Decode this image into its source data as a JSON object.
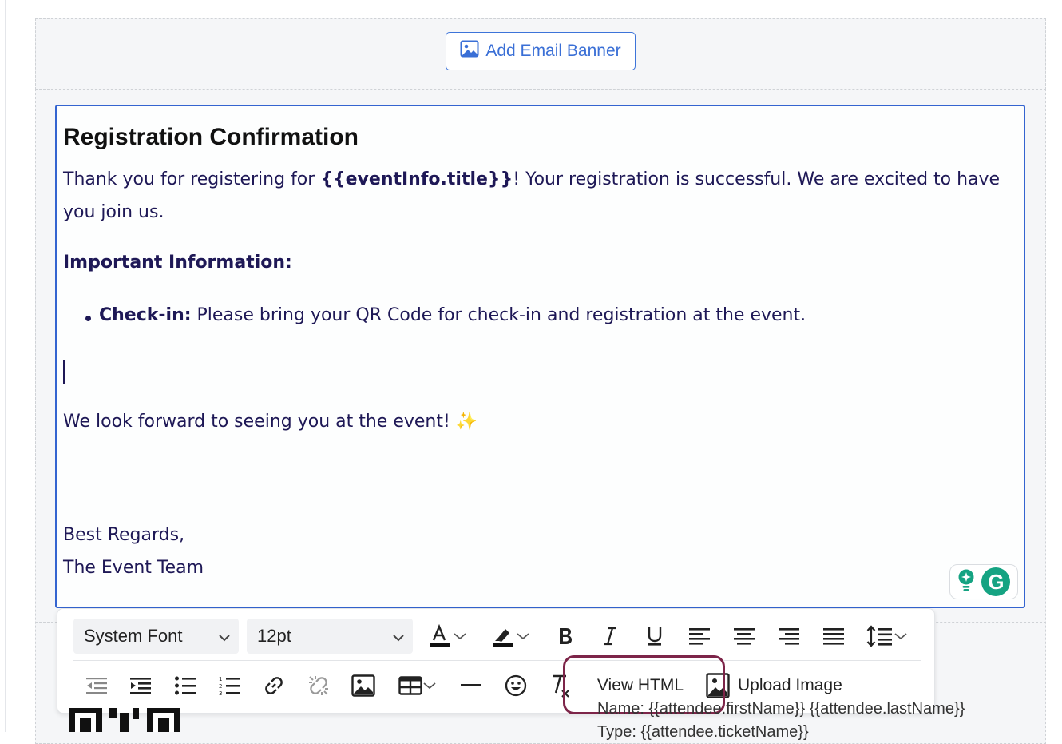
{
  "banner": {
    "button_label": "Add Email Banner"
  },
  "email": {
    "heading": "Registration Confirmation",
    "intro_before": "Thank you for registering for ",
    "intro_placeholder": "{{eventInfo.title}}",
    "intro_after": "! Your registration is successful. We are excited to have you join us.",
    "important_heading": "Important Information:",
    "bullet_label": "Check-in:",
    "bullet_text": " Please bring your QR Code for check-in and registration at the event.",
    "closing": "We look forward to seeing you at the event! ",
    "closing_emoji": "✨",
    "regards_line1": "Best Regards,",
    "regards_line2": "The Event Team"
  },
  "toolbar": {
    "font_family": "System Font",
    "font_size": "12pt",
    "view_html_label": "View HTML",
    "upload_image_label": "Upload Image"
  },
  "background": {
    "name_line": "Name: {{attendee.firstName}} {{attendee.lastName}}",
    "ticket_line": "Type: {{attendee.ticketName}}"
  },
  "colors": {
    "accent": "#3464d0",
    "text": "#1e1856",
    "highlight_ring": "#7d2549",
    "grammarly": "#15a382"
  }
}
